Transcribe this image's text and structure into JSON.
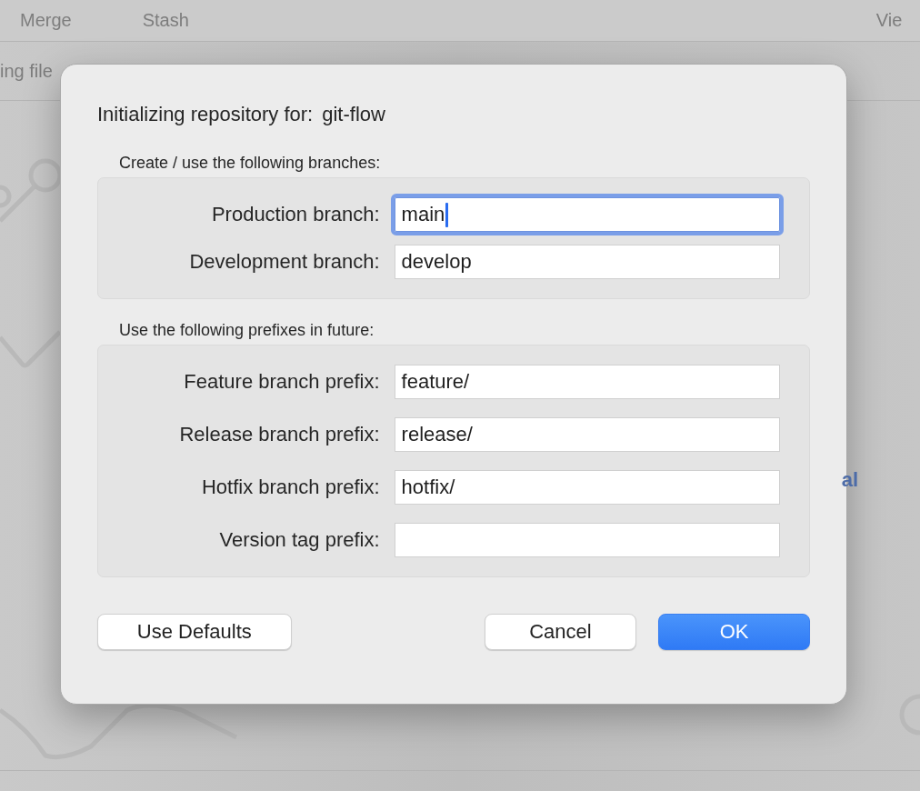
{
  "toolbar": {
    "items": [
      "Merge",
      "Stash",
      "Vie"
    ]
  },
  "subbar": {
    "text": "ing file"
  },
  "background_text": "al",
  "dialog": {
    "title": "Initializing repository for:",
    "repository": "git-flow",
    "groups": [
      {
        "label": "Create / use the following branches:",
        "fields": [
          {
            "label": "Production branch:",
            "value": "main",
            "focused": true
          },
          {
            "label": "Development branch:",
            "value": "develop",
            "focused": false
          }
        ]
      },
      {
        "label": "Use the following prefixes in future:",
        "fields": [
          {
            "label": "Feature branch prefix:",
            "value": "feature/",
            "focused": false
          },
          {
            "label": "Release branch prefix:",
            "value": "release/",
            "focused": false
          },
          {
            "label": "Hotfix branch prefix:",
            "value": "hotfix/",
            "focused": false
          },
          {
            "label": "Version tag prefix:",
            "focused": false
          }
        ]
      }
    ],
    "buttons": [
      {
        "label": "Use Defaults",
        "kind": "secondary"
      },
      {
        "label": "Cancel",
        "kind": "secondary"
      },
      {
        "label": "OK",
        "kind": "default"
      }
    ]
  }
}
